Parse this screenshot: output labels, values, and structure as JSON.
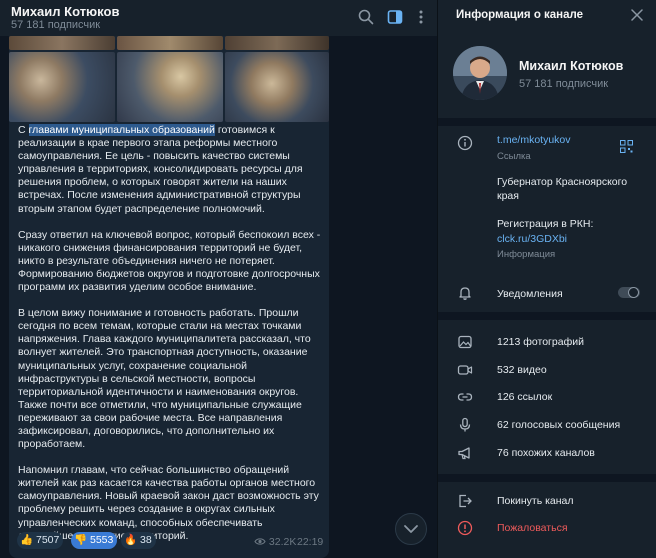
{
  "chat": {
    "title": "Михаил Котюков",
    "subtitle": "57 181 подписчик",
    "post": {
      "highlight": "главами муниципальных образований",
      "p1_start": "С ",
      "p1_rest": " готовимся к реализации в крае первого этапа реформы местного самоуправления. Ее цель - повысить качество системы управления в территориях, консолидировать ресурсы для решения проблем, о которых говорят жители на наших встречах. После изменения административной структуры вторым этапом будет распределение полномочий.",
      "p2": "Сразу ответил на ключевой вопрос, который беспокоил всех - никакого снижения финансирования территорий не будет, никто в результате объединения ничего не потеряет. Формированию бюджетов округов и подготовке долгосрочных программ их развития уделим особое внимание.",
      "p3": "В целом вижу понимание и готовность работать. Прошли сегодня по всем темам, которые стали на местах точками напряжения. Глава каждого муниципалитета рассказал, что волнует жителей. Это транспортная доступность, оказание муниципальных услуг, сохранение социальной инфраструктуры в сельской местности, вопросы территориальной идентичности и наименования округов. Также почти все отметили, что муниципальные служащие переживают за свои рабочие места. Все направления зафиксировал, договорились, что дополнительно их проработаем.",
      "p4": "Напомнил главам, что сейчас большинство обращений жителей как раз касается качества работы органов местного самоуправления. Новый краевой закон даст возможность эту проблему решить через создание в округах сильных управленческих команд, способных обеспечивать дальнейшее развитие территорий."
    },
    "reactions": [
      {
        "emoji": "👍",
        "count": "7507"
      },
      {
        "emoji": "👎",
        "count": "5553"
      },
      {
        "emoji": "🔥",
        "count": "38"
      }
    ],
    "views": "32.2K",
    "time": "22:19"
  },
  "panel": {
    "title": "Информация о канале",
    "name": "Михаил Котюков",
    "subscribers": "57 181 подписчик",
    "link": "t.me/mkotyukov",
    "link_label": "Ссылка",
    "description_line1": "Губернатор Красноярского",
    "description_line2": "края",
    "registration": "Регистрация в РКН:",
    "registration_link": "clck.ru/3GDXbi",
    "registration_label": "Информация",
    "notifications": "Уведомления",
    "notifications_on": false,
    "media": [
      {
        "icon": "photo-icon",
        "label": "1213 фотографий"
      },
      {
        "icon": "video-icon",
        "label": "532 видео"
      },
      {
        "icon": "link-icon",
        "label": "126 ссылок"
      },
      {
        "icon": "microphone-icon",
        "label": "62 голосовых сообщения"
      },
      {
        "icon": "megaphone-icon",
        "label": "76 похожих каналов"
      }
    ],
    "leave": "Покинуть канал",
    "report": "Пожаловаться"
  },
  "colors": {
    "accent": "#6ab3f3",
    "danger": "#ef5b5b",
    "bubble": "#182533",
    "panel": "#17212b"
  }
}
